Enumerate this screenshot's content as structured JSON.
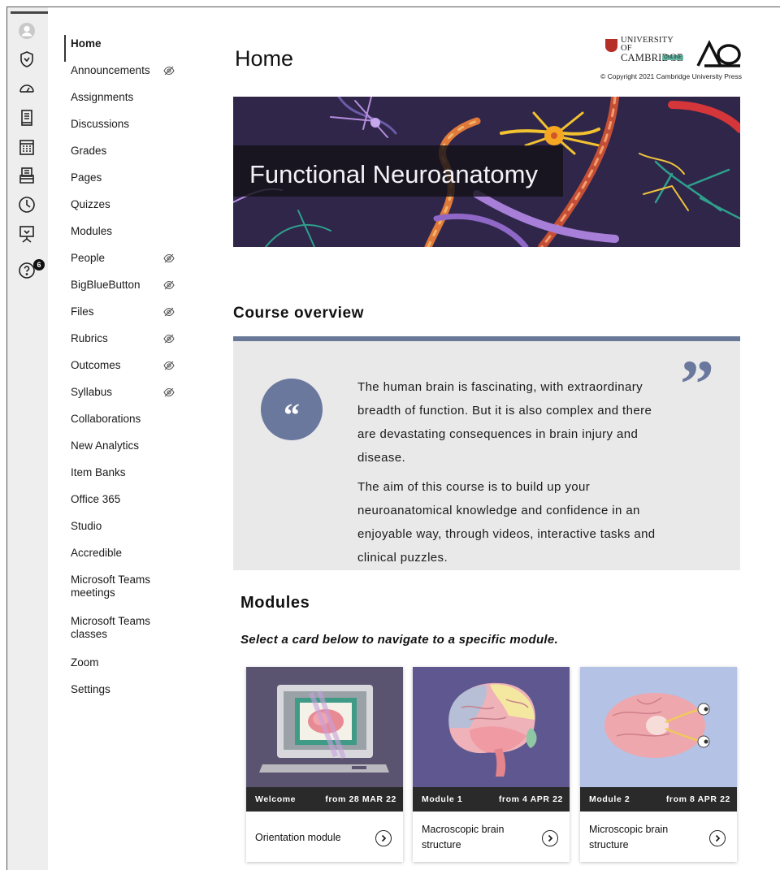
{
  "rail": {
    "icons": [
      "avatar-icon",
      "admin-shield-icon",
      "dashboard-gauge-icon",
      "courses-book-icon",
      "calendar-icon",
      "inbox-icon",
      "history-clock-icon",
      "studio-presentation-icon",
      "help-icon"
    ],
    "help_badge": "6"
  },
  "course_nav": {
    "items": [
      {
        "label": "Home",
        "active": true,
        "hidden": false
      },
      {
        "label": "Announcements",
        "hidden": true
      },
      {
        "label": "Assignments",
        "hidden": false
      },
      {
        "label": "Discussions",
        "hidden": false
      },
      {
        "label": "Grades",
        "hidden": false
      },
      {
        "label": "Pages",
        "hidden": false
      },
      {
        "label": "Quizzes",
        "hidden": false
      },
      {
        "label": "Modules",
        "hidden": false
      },
      {
        "label": "People",
        "hidden": true
      },
      {
        "label": "BigBlueButton",
        "hidden": true
      },
      {
        "label": "Files",
        "hidden": true
      },
      {
        "label": "Rubrics",
        "hidden": true
      },
      {
        "label": "Outcomes",
        "hidden": true
      },
      {
        "label": "Syllabus",
        "hidden": true
      },
      {
        "label": "Collaborations",
        "hidden": false
      },
      {
        "label": "New Analytics",
        "hidden": false
      },
      {
        "label": "Item Banks",
        "hidden": false
      },
      {
        "label": "Office 365",
        "hidden": false
      },
      {
        "label": "Studio",
        "hidden": false
      },
      {
        "label": "Accredible",
        "hidden": false
      },
      {
        "label": "Microsoft Teams meetings",
        "hidden": false
      },
      {
        "label": "Microsoft Teams classes",
        "hidden": false
      },
      {
        "label": "Zoom",
        "hidden": false
      },
      {
        "label": "Settings",
        "hidden": false
      }
    ]
  },
  "header": {
    "page_title": "Home",
    "university_line1": "UNIVERSITY OF",
    "university_line2": "CAMBRIDGE",
    "university_online": "ONLINE",
    "copyright": "© Copyright 2021 Cambridge University Press"
  },
  "banner": {
    "title": "Functional Neuroanatomy"
  },
  "overview": {
    "title": "Course overview",
    "open_quote": "“",
    "close_quote": "”",
    "paragraph1": "The human brain is fascinating, with extraordinary breadth of function. But it is also complex and there are devastating consequences in brain injury and disease.",
    "paragraph2": "The aim of this course is to build up your neuroanatomical knowledge and confidence in an enjoyable way, through videos, interactive tasks and clinical puzzles."
  },
  "modules": {
    "title": "Modules",
    "subtitle": "Select a card below to navigate to a specific module.",
    "cards": [
      {
        "tag": "Welcome",
        "date": "from 28 MAR 22",
        "name": "Orientation module"
      },
      {
        "tag": "Module 1",
        "date": "from 4 APR 22",
        "name": "Macroscopic brain structure"
      },
      {
        "tag": "Module 2",
        "date": "from 8 APR 22",
        "name": "Microscopic brain structure"
      }
    ]
  },
  "colors": {
    "accent_slate": "#6b789e",
    "overview_bg": "#e9e9e9",
    "card_strip": "#2a2a2a",
    "cambridge_red": "#b52e27"
  }
}
